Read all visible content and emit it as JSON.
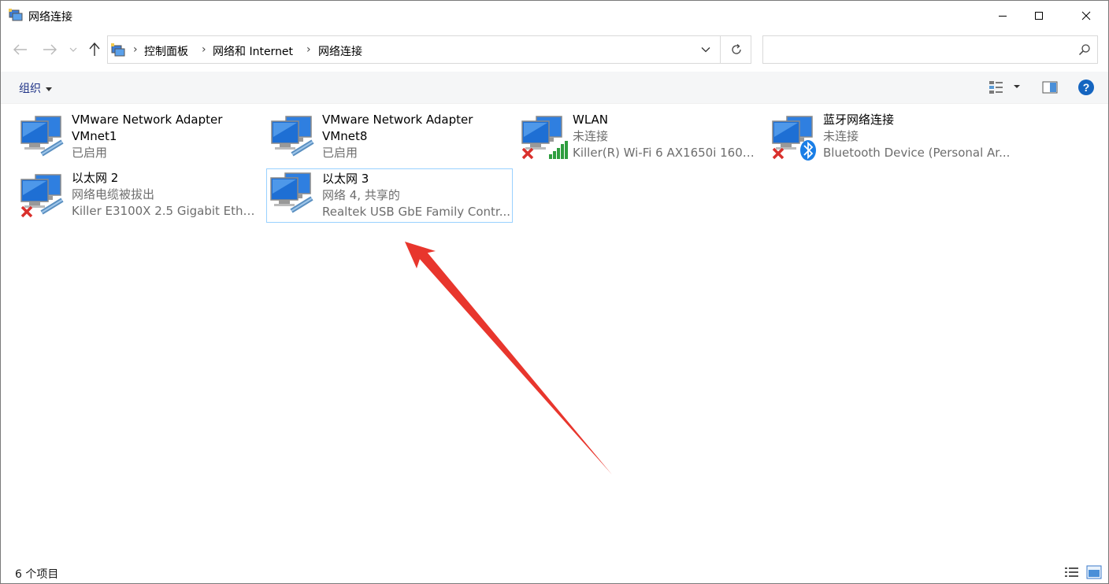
{
  "window": {
    "title": "网络连接",
    "icon": "network-connections-icon"
  },
  "nav": {
    "back_icon": "arrow-left-icon",
    "forward_icon": "arrow-right-icon",
    "recent_icon": "chevron-down-icon",
    "up_icon": "arrow-up-icon"
  },
  "breadcrumb": {
    "items": [
      "控制面板",
      "网络和 Internet",
      "网络连接"
    ]
  },
  "search": {
    "placeholder": "",
    "value": ""
  },
  "toolbar": {
    "organize_label": "组织",
    "view_icon": "change-view-icon",
    "preview_icon": "preview-pane-icon",
    "help_icon": "help-icon"
  },
  "items": [
    {
      "title": "VMware Network Adapter",
      "line1": "VMnet1",
      "line2": "已启用",
      "status": "enabled",
      "overlay": "none"
    },
    {
      "title": "VMware Network Adapter",
      "line1": "VMnet8",
      "line2": "已启用",
      "status": "enabled",
      "overlay": "none"
    },
    {
      "title": "WLAN",
      "line1": "未连接",
      "line2": "Killer(R) Wi-Fi 6 AX1650i 160M...",
      "status": "disconnected",
      "overlay": "wifi-signal"
    },
    {
      "title": "蓝牙网络连接",
      "line1": "未连接",
      "line2": "Bluetooth Device (Personal Ar...",
      "status": "disconnected",
      "overlay": "bluetooth"
    },
    {
      "title": "以太网 2",
      "line1": "网络电缆被拔出",
      "line2": "Killer E3100X 2.5 Gigabit Ether...",
      "status": "disconnected",
      "overlay": "cable"
    },
    {
      "title": "以太网 3",
      "line1": "网络 4, 共享的",
      "line2": "Realtek USB GbE Family Contr...",
      "status": "enabled",
      "overlay": "cable",
      "selected": true
    }
  ],
  "statusbar": {
    "count": "6 个项目",
    "details_view_icon": "details-view-icon",
    "large_icons_view_icon": "large-icons-view-icon"
  },
  "colors": {
    "selection_border": "#99d1ff",
    "annotation_arrow": "#e8362d",
    "link_blue": "#1e3287",
    "error_red": "#d9302c"
  }
}
